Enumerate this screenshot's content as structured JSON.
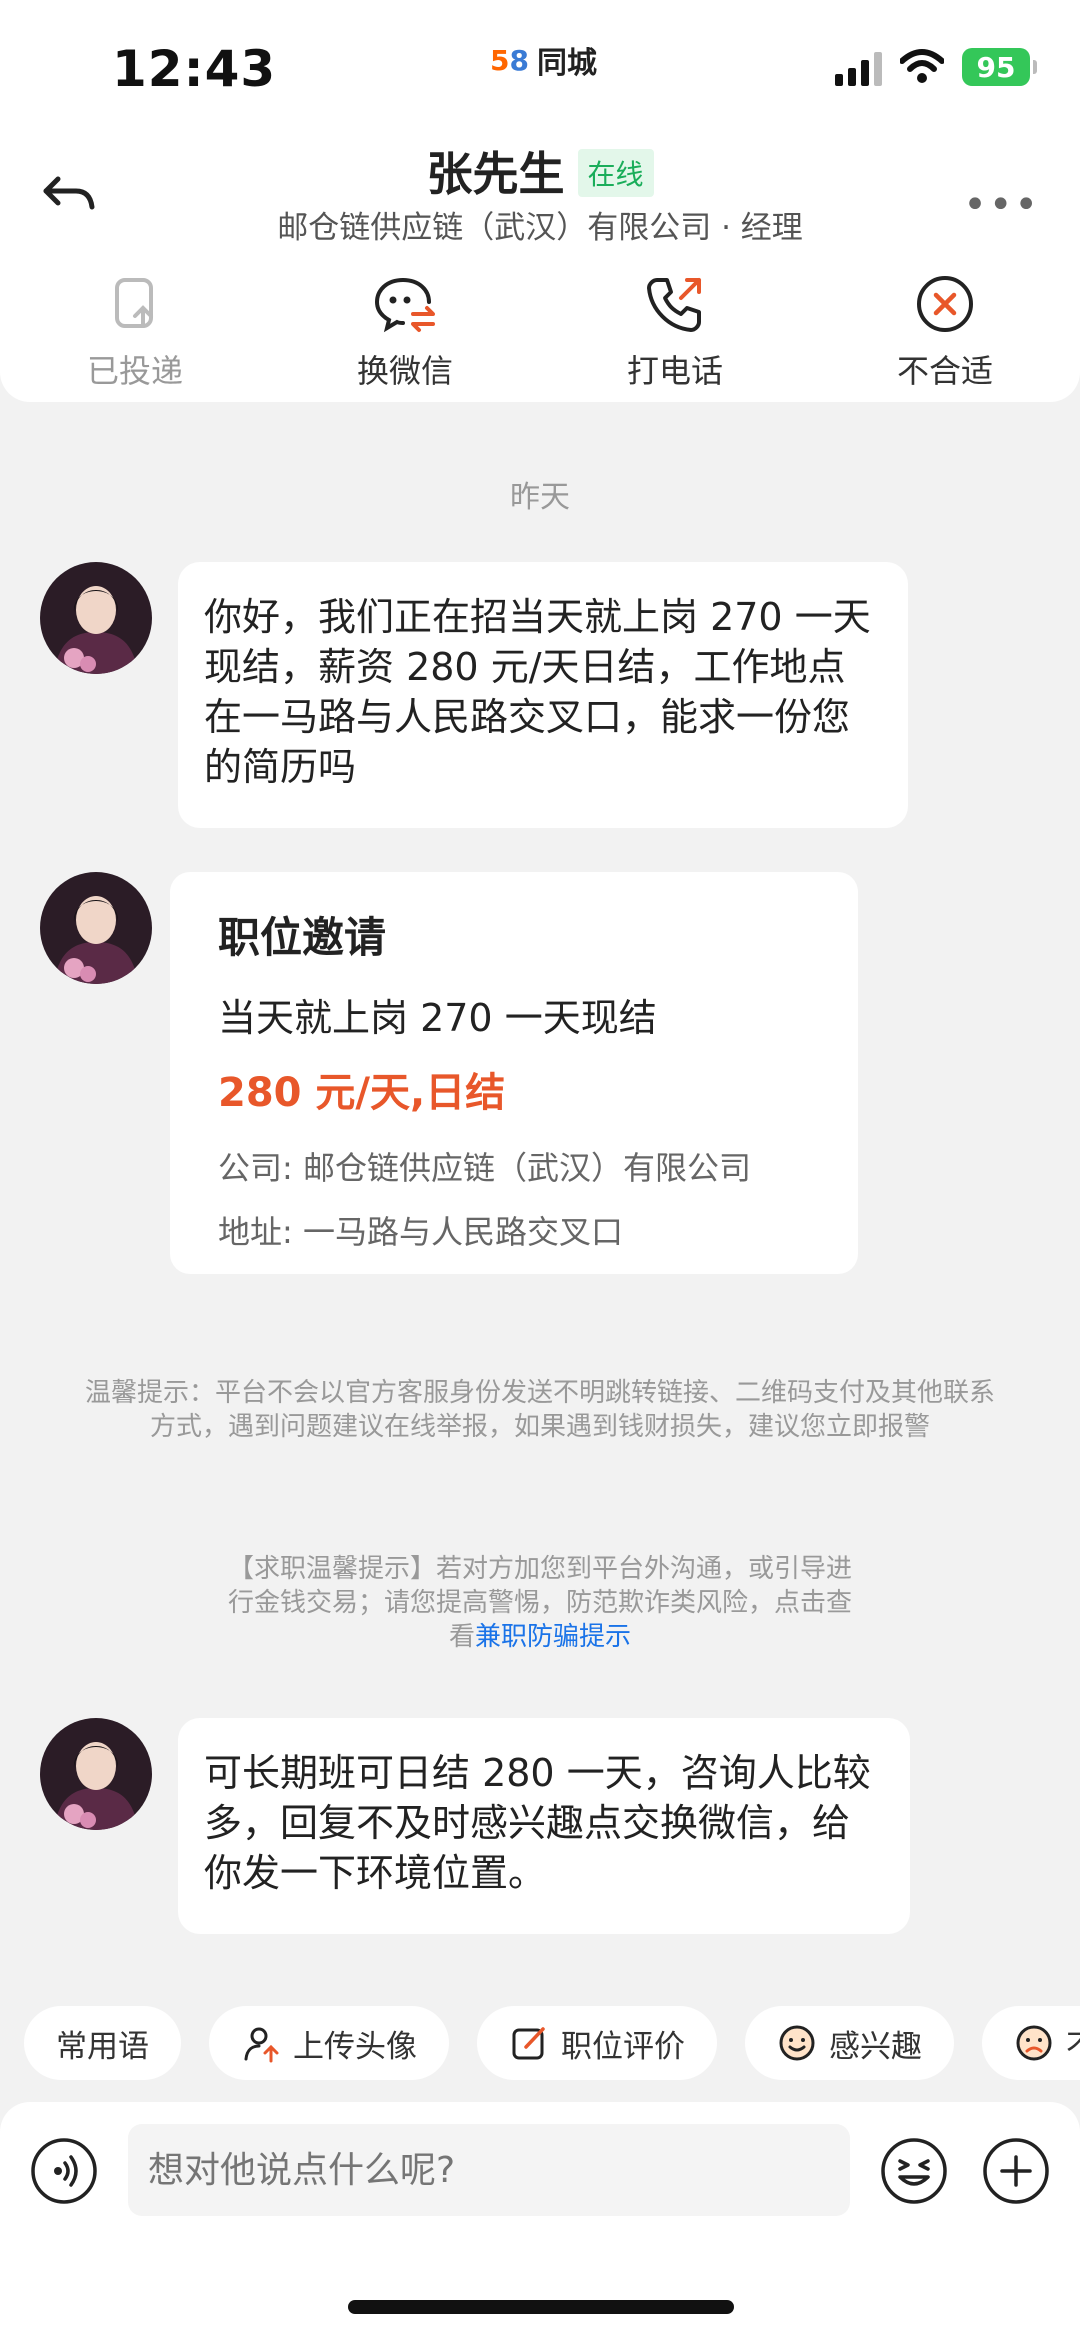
{
  "status": {
    "time": "12:43",
    "carrier_logo": "58",
    "carrier": "同城",
    "battery": "95"
  },
  "header": {
    "name": "张先生",
    "online": "在线",
    "subtitle": "邮仓链供应链（武汉）有限公司 · 经理",
    "more": "•••"
  },
  "actions": [
    {
      "label": "已投递",
      "icon": "delivered-icon"
    },
    {
      "label": "换微信",
      "icon": "wechat-exchange-icon"
    },
    {
      "label": "打电话",
      "icon": "phone-call-icon"
    },
    {
      "label": "不合适",
      "icon": "reject-icon"
    }
  ],
  "chat": {
    "date": "昨天",
    "msg1": "你好，我们正在招当天就上岗 270 一天现结，薪资 280 元/天日结，工作地点在一马路与人民路交叉口，能求一份您的简历吗",
    "card": {
      "title": "职位邀请",
      "job": "当天就上岗 270 一天现结",
      "salary": "280 元/天,日结",
      "company": "公司: 邮仓链供应链（武汉）有限公司",
      "address": "地址: 一马路与人民路交叉口"
    },
    "tip1": "温馨提示：平台不会以官方客服身份发送不明跳转链接、二维码支付及其他联系方式，遇到问题建议在线举报，如果遇到钱财损失，建议您立即报警",
    "tip2_text": "【求职温馨提示】若对方加您到平台外沟通，或引导进行金钱交易；请您提高警惕，防范欺诈类风险，点击查看",
    "tip2_link": "兼职防骗提示",
    "msg2": "可长期班可日结 280 一天，咨询人比较多，回复不及时感兴趣点交换微信，给你发一下环境位置。"
  },
  "chips": [
    {
      "label": "常用语"
    },
    {
      "label": "上传头像",
      "icon": "upload-avatar-icon"
    },
    {
      "label": "职位评价",
      "icon": "edit-review-icon"
    },
    {
      "label": "感兴趣",
      "icon": "smile-icon"
    },
    {
      "label": "不",
      "icon": "sad-icon"
    }
  ],
  "input": {
    "placeholder": "想对他说点什么呢?"
  },
  "colors": {
    "accent_orange": "#e8572a",
    "online_green": "#1aad5a",
    "link_blue": "#1a73e8"
  }
}
